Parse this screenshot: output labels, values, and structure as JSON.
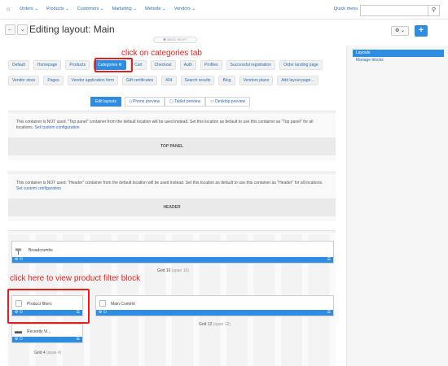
{
  "nav": {
    "home_icon": "home-icon",
    "menu": [
      "Orders ⌄",
      "Products ⌄",
      "Customers ⌄",
      "Marketing ⌄",
      "Website ⌄",
      "Vendors ⌄"
    ],
    "quick_menu": "Quick menu",
    "search_placeholder": ""
  },
  "header": {
    "back": "←",
    "dropdown": "⌄",
    "title": "Editing layout: Main",
    "gear": "⚙ ⌄",
    "plus": "+"
  },
  "need_help": "❶ NEED HELP?",
  "annotations": {
    "categories": "click on categories tab",
    "product_filter": "click here to view product filter block"
  },
  "tabs_row1": [
    "Default",
    "Homepage",
    "Products",
    "Categories ⚙",
    "Cart",
    "Checkout",
    "Auth",
    "Profiles",
    "Successful registration",
    "Order landing page"
  ],
  "tabs_row2": [
    "Vendor store",
    "Pages",
    "Vendor application form",
    "Gift certificates",
    "404",
    "Search results",
    "Blog",
    "Vendors plans",
    "Add layout page..."
  ],
  "preview": {
    "edit": "Edit layouts",
    "phone": "▯ Phone preview",
    "tablet": "▢ Tablet preview",
    "desktop": "▭ Desktop preview"
  },
  "top_panel": {
    "msg": "This container is NOT used. \"Top panel\" container from the default location will be used instead. Set this location as default to use this container as \"Top panel\" for all locations.",
    "link": "Set custom configuration",
    "label": "TOP PANEL"
  },
  "header_panel": {
    "msg": "This container is NOT used. \"Header\" container from the default location will be used instead. Set this location as default to use this container as \"Header\" for all locations.",
    "link": "Set custom configuration",
    "label": "HEADER"
  },
  "blocks": {
    "breadcrumbs": "Breadcrumbs",
    "grid16": "Grid 16",
    "grid16_span": "(span 16)",
    "product_filters": "Product filters",
    "recently": "Recently Vi...",
    "main_content": "Main Content",
    "grid12": "Grid 12",
    "grid12_span": "(span 12)",
    "grid4": "Grid 4",
    "grid4_span": "(span 4)",
    "bar_icons": "⚙ ⏻",
    "bar_right": "☰"
  },
  "sidebar": {
    "layouts": "Layouts",
    "manage": "Manage blocks"
  },
  "colors": {
    "accent": "#2e8de0",
    "annotation": "#e32020"
  }
}
